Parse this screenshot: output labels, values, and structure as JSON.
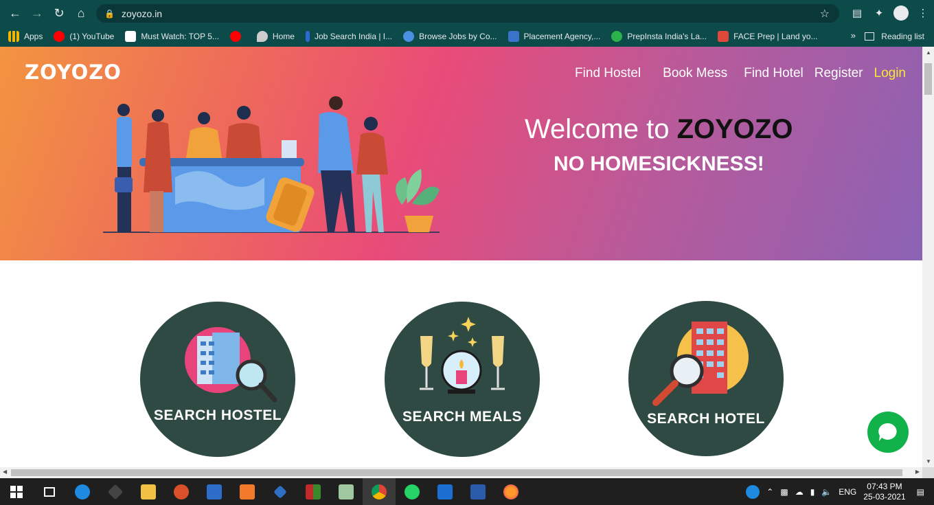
{
  "browser": {
    "url": "zoyozo.in",
    "bookmarks": [
      {
        "label": "Apps",
        "color": "#f4b400"
      },
      {
        "label": "(1) YouTube",
        "color": "#ff0000"
      },
      {
        "label": "Must Watch: TOP 5...",
        "color": "#ffffff"
      },
      {
        "label": "",
        "color": "#ff0000"
      },
      {
        "label": "Home",
        "color": "#cccccc"
      },
      {
        "label": "Job Search India | I...",
        "color": "#2c6bd6"
      },
      {
        "label": "Browse Jobs by Co...",
        "color": "#4a90e2"
      },
      {
        "label": "Placement Agency,...",
        "color": "#3a73c9"
      },
      {
        "label": "PrepInsta India's La...",
        "color": "#2bb24c"
      },
      {
        "label": "FACE Prep | Land yo...",
        "color": "#e0483c"
      }
    ],
    "more": "»",
    "reading_list": "Reading list"
  },
  "site": {
    "logo": "ZOYOZO",
    "nav": [
      "Find Hostel",
      "Book Mess",
      "Find Hotel",
      "Register",
      "Login"
    ],
    "welcome_prefix": "Welcome to ",
    "welcome_brand": "ZOYOZO",
    "tagline": "NO HOMESICKNESS!",
    "cards": [
      {
        "label": "SEARCH HOSTEL"
      },
      {
        "label": "SEARCH MEALS"
      },
      {
        "label": "SEARCH HOTEL"
      }
    ]
  },
  "taskbar": {
    "lang": "ENG",
    "time": "07:43 PM",
    "date": "25-03-2021"
  }
}
